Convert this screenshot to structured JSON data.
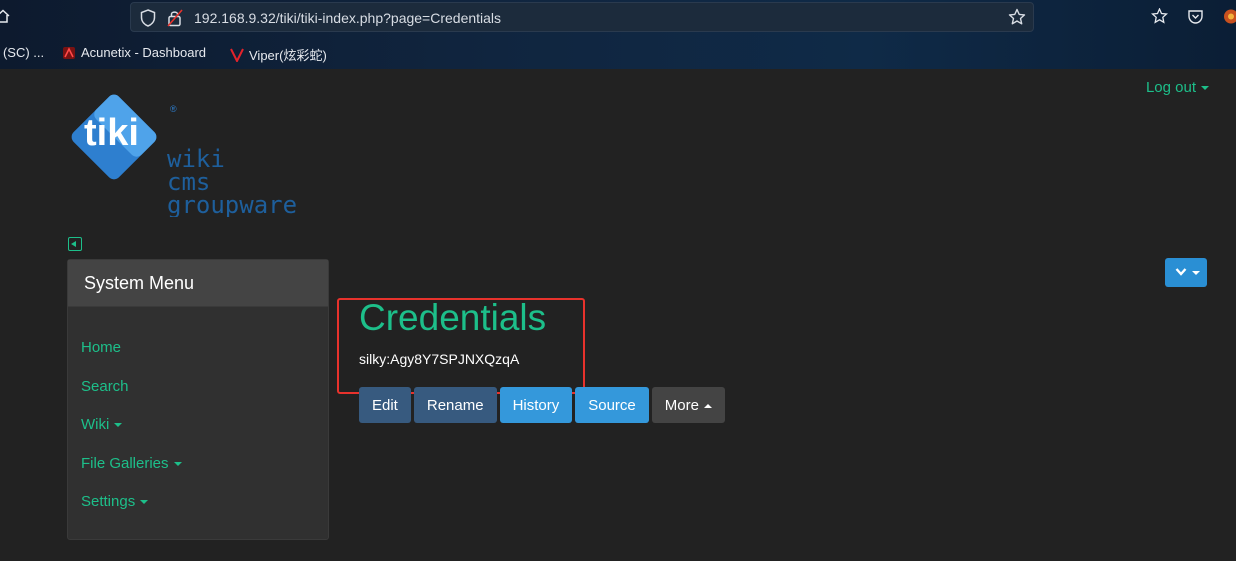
{
  "browser": {
    "url": "192.168.9.32/tiki/tiki-index.php?page=Credentials",
    "bookmarks": [
      {
        "label": "r (SC) ..."
      },
      {
        "label": "Acunetix - Dashboard"
      },
      {
        "label": "Viper(炫彩蛇)"
      }
    ]
  },
  "header": {
    "logout_label": "Log out"
  },
  "logo": {
    "brand": "tiki",
    "lines": [
      "wiki",
      "cms",
      "groupware"
    ]
  },
  "sidebar": {
    "title": "System Menu",
    "items": [
      {
        "label": "Home",
        "has_caret": false
      },
      {
        "label": "Search",
        "has_caret": false
      },
      {
        "label": "Wiki",
        "has_caret": true
      },
      {
        "label": "File Galleries",
        "has_caret": true
      },
      {
        "label": "Settings",
        "has_caret": true
      }
    ]
  },
  "main": {
    "title": "Credentials",
    "content": "silky:Agy8Y7SPJNXQzqA",
    "actions": {
      "edit": "Edit",
      "rename": "Rename",
      "history": "History",
      "source": "Source",
      "more": "More"
    }
  },
  "colors": {
    "accent": "#1dbf8a",
    "primary_dark": "#375a7f",
    "info": "#3498db",
    "highlight": "#e8322c",
    "background": "#222222"
  }
}
